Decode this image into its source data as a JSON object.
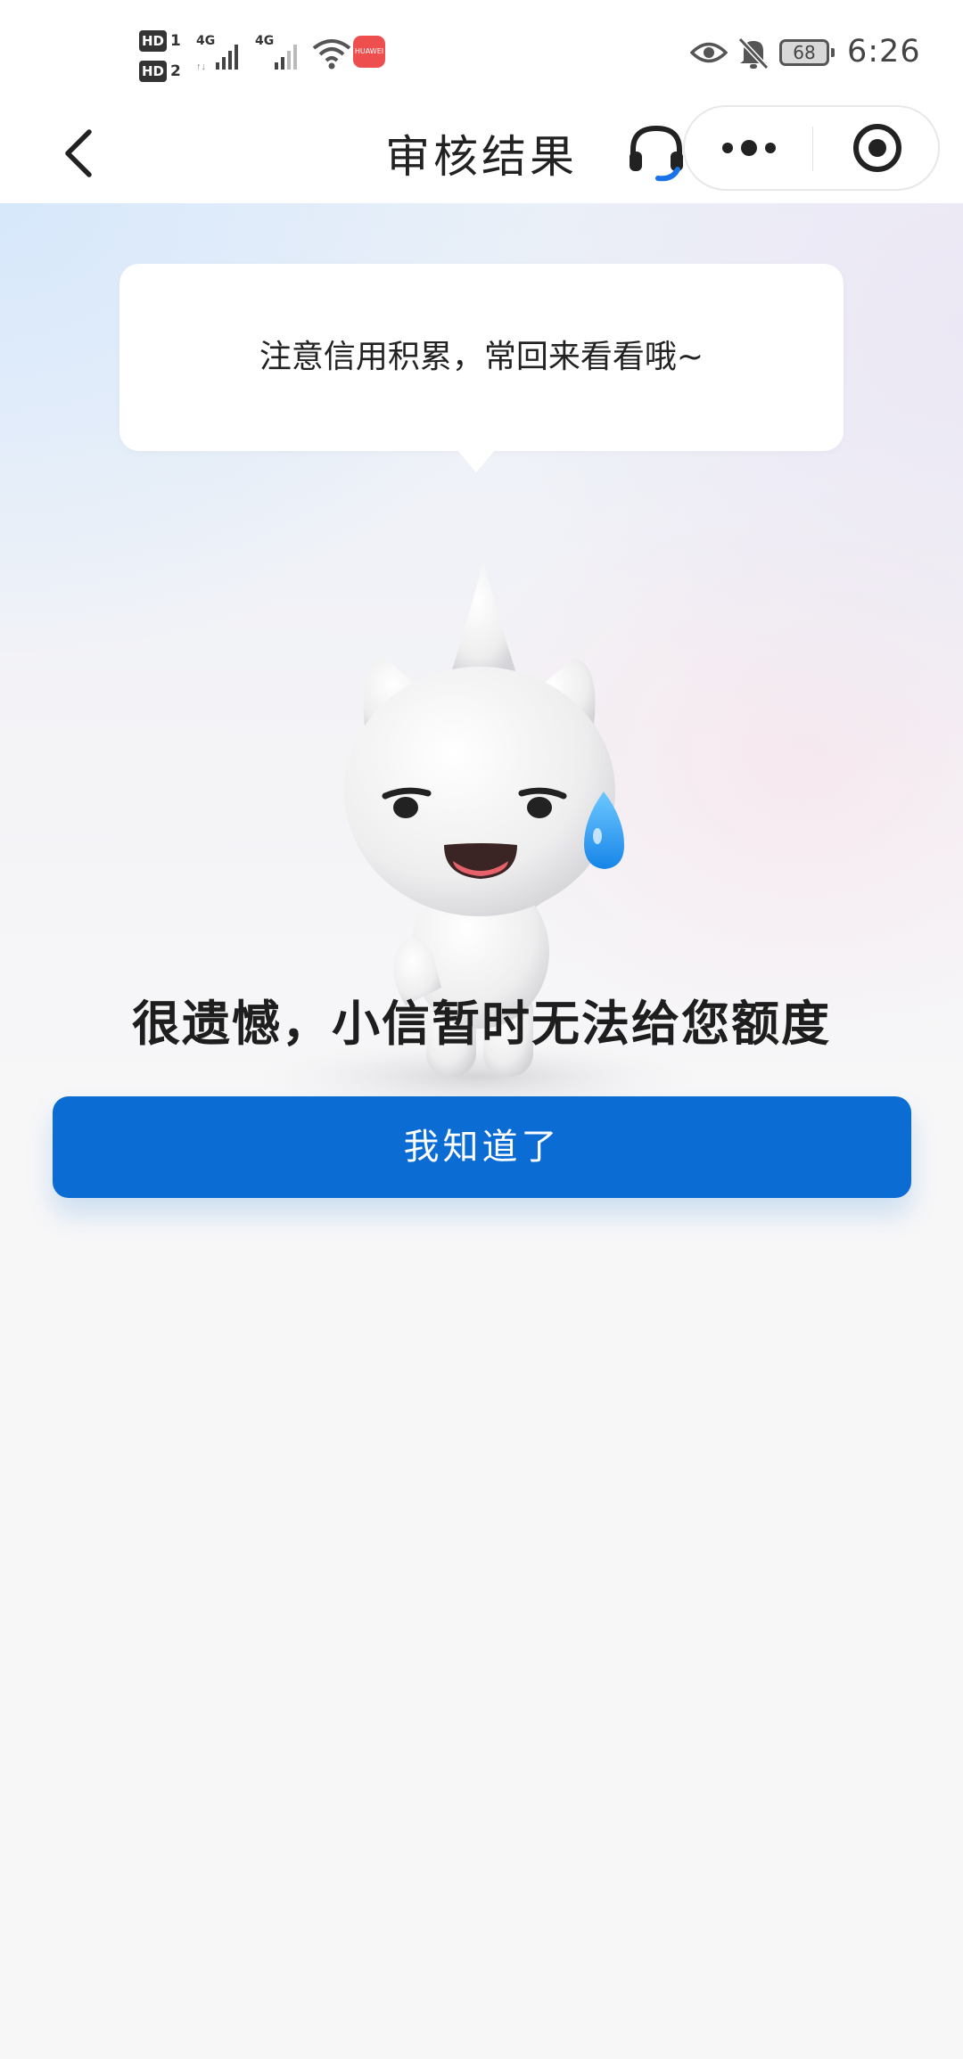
{
  "status_bar": {
    "hd1": "HD",
    "sim1": "1",
    "hd2": "HD",
    "sim2": "2",
    "net1": "4G",
    "net2": "4G",
    "app_badge_text": "HUAWEI",
    "battery": "68",
    "time": "6:26"
  },
  "nav": {
    "title": "审核结果",
    "back_icon": "chevron-left-icon",
    "service_icon": "headset-icon",
    "more_icon": "more-dots-icon",
    "close_icon": "target-close-icon"
  },
  "hero": {
    "bubble_text": "注意信用积累，常回来看看哦~",
    "mascot": "white-cat-mascot-sweat-drop"
  },
  "result": {
    "title": "很遗憾，小信暂时无法给您额度"
  },
  "actions": {
    "confirm_label": "我知道了"
  },
  "colors": {
    "primary": "#0b6dd4",
    "accent_headset": "#1a73e8",
    "background": "#f7f7f8"
  }
}
